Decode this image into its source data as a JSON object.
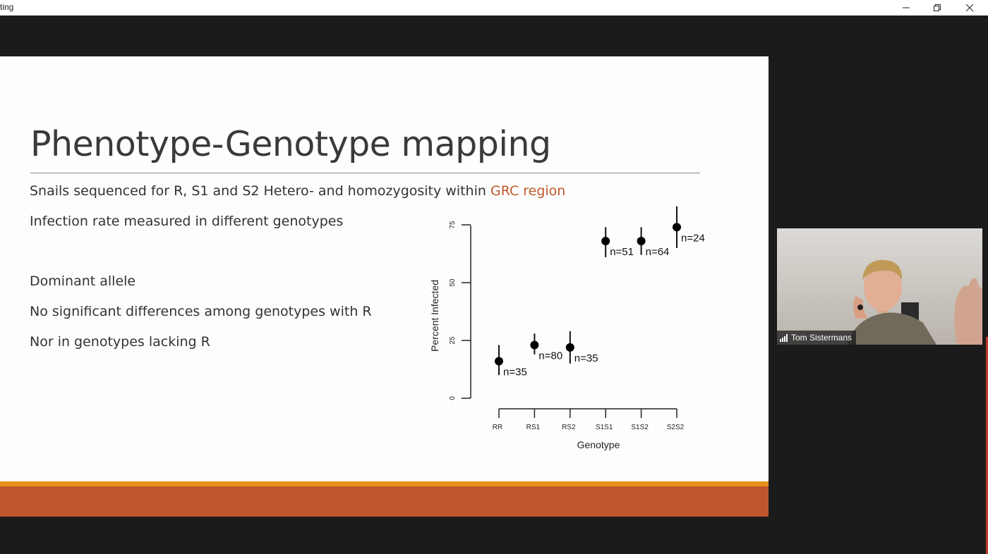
{
  "window": {
    "title": "ting",
    "minimize_icon": "minimize-icon",
    "restore_icon": "restore-icon",
    "close_icon": "close-icon"
  },
  "slide": {
    "title": "Phenotype-Genotype mapping",
    "bullets": {
      "b1_prefix": "Snails sequenced for R, S1 and S2 Hetero- and homozygosity within ",
      "b1_highlight": "GRC region",
      "b2": "Infection rate measured in different genotypes",
      "b3": "Dominant allele",
      "b4": "No significant differences among genotypes with R",
      "b5": "Nor in genotypes lacking R"
    },
    "colors": {
      "accent": "#c0572b",
      "footer_top": "#e8901c",
      "footer": "#c0562b"
    }
  },
  "chart_data": {
    "type": "scatter",
    "xlabel": "Genotype",
    "ylabel": "Percent Infected",
    "categories": [
      "RR",
      "RS1",
      "RS2",
      "S1S1",
      "S1S2",
      "S2S2"
    ],
    "values": [
      16,
      23,
      22,
      68,
      68,
      74
    ],
    "err_low": [
      10,
      19,
      15,
      61,
      62,
      65
    ],
    "err_high": [
      23,
      28,
      29,
      74,
      74,
      83
    ],
    "n_labels": [
      "n=35",
      "n=80",
      "n=35",
      "n=51",
      "n=64",
      "n=24"
    ],
    "yticks": [
      "0",
      "25",
      "50",
      "75"
    ],
    "ylim": [
      0,
      75
    ],
    "grid": false
  },
  "video": {
    "participant_name": "Tom Sistermans",
    "signal_icon": "signal-icon"
  }
}
